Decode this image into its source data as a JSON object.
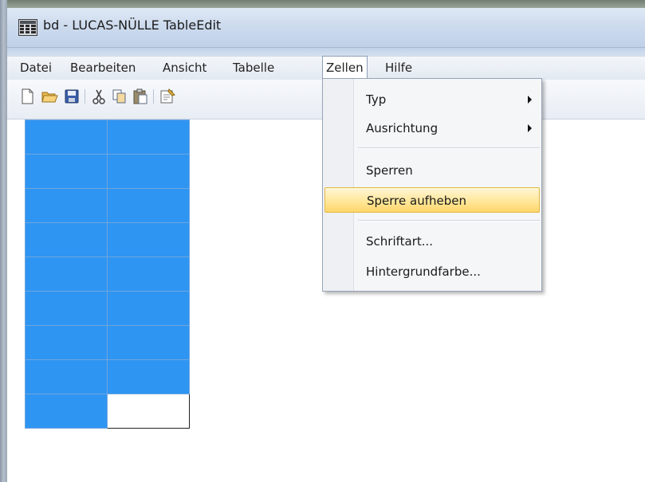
{
  "window": {
    "title": "bd - LUCAS-NÜLLE TableEdit",
    "icon": "table-edit-app-icon"
  },
  "menubar": {
    "items": [
      {
        "label": "Datei"
      },
      {
        "label": "Bearbeiten"
      },
      {
        "label": "Ansicht"
      },
      {
        "label": "Tabelle"
      },
      {
        "label": "Zellen",
        "open": true
      },
      {
        "label": "Hilfe"
      }
    ]
  },
  "toolbar": {
    "buttons": [
      {
        "icon": "new-document-icon"
      },
      {
        "icon": "open-folder-icon"
      },
      {
        "icon": "save-icon"
      },
      {
        "icon": "cut-icon"
      },
      {
        "icon": "copy-icon"
      },
      {
        "icon": "paste-icon"
      },
      {
        "icon": "properties-icon"
      }
    ]
  },
  "dropdown": {
    "items": [
      {
        "label": "Typ",
        "submenu": true
      },
      {
        "label": "Ausrichtung",
        "submenu": true
      },
      {
        "label": "Sperren"
      },
      {
        "label": "Sperre aufheben",
        "highlighted": true
      },
      {
        "label": "Schriftart..."
      },
      {
        "label": "Hintergrundfarbe..."
      }
    ]
  },
  "colors": {
    "cell_blue": "#2f95f2",
    "highlight": "#ffe79a"
  }
}
